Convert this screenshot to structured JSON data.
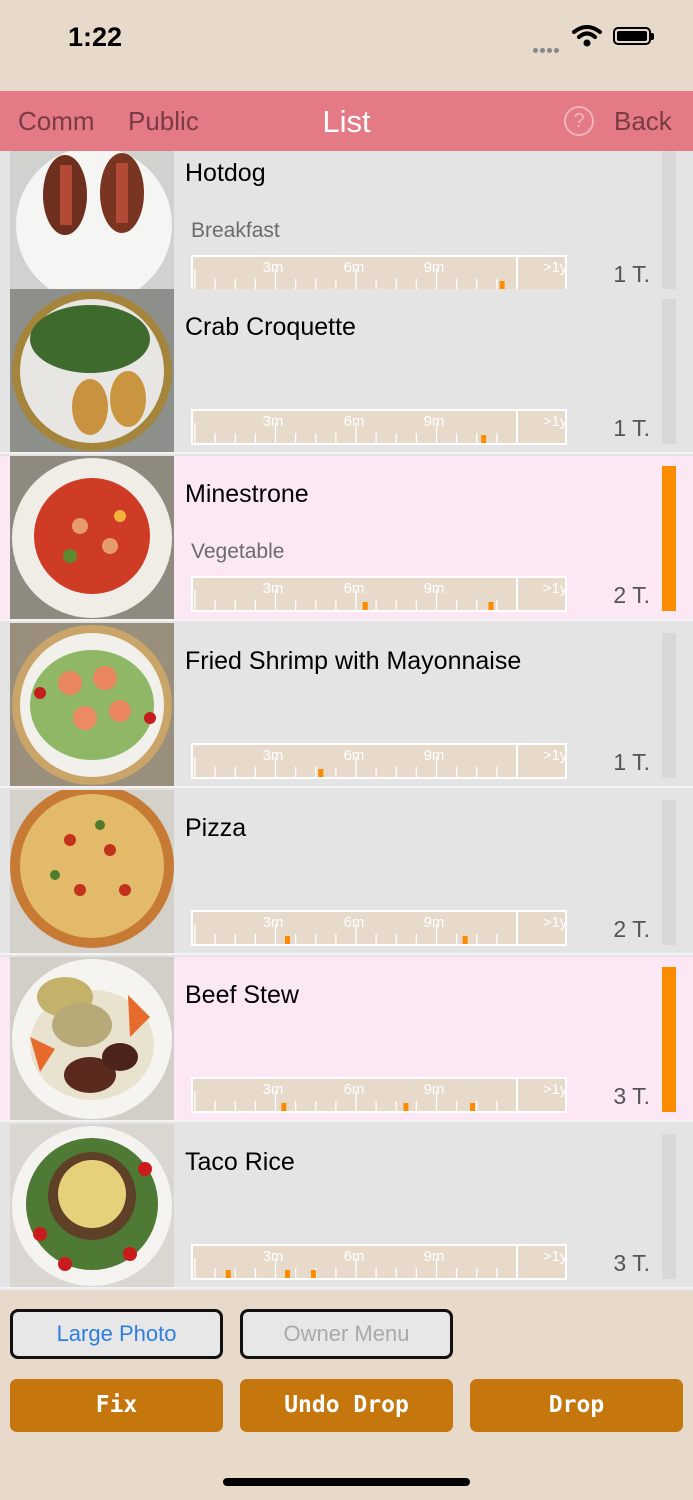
{
  "status": {
    "time": "1:22"
  },
  "nav": {
    "left1": "Comm",
    "left2": "Public",
    "title": "List",
    "help_icon": "?",
    "back": "Back"
  },
  "timeline_labels": [
    "3m",
    "6m",
    "9m",
    ">1y"
  ],
  "rows": [
    {
      "name": "Hotdog",
      "category": "Breakfast",
      "times": "1 T.",
      "highlight": false,
      "marks": [
        0.83
      ]
    },
    {
      "name": "Crab Croquette",
      "category": "",
      "times": "1 T.",
      "highlight": false,
      "marks": [
        0.78
      ]
    },
    {
      "name": "Minestrone",
      "category": "Vegetable",
      "times": "2 T.",
      "highlight": true,
      "marks": [
        0.46,
        0.8
      ]
    },
    {
      "name": "Fried Shrimp with Mayonnaise",
      "category": "",
      "times": "1 T.",
      "highlight": false,
      "marks": [
        0.34
      ]
    },
    {
      "name": "Pizza",
      "category": "",
      "times": "2 T.",
      "highlight": false,
      "marks": [
        0.25,
        0.73
      ]
    },
    {
      "name": "Beef Stew",
      "category": "",
      "times": "3 T.",
      "highlight": true,
      "marks": [
        0.24,
        0.57,
        0.75
      ]
    },
    {
      "name": "Taco Rice",
      "category": "",
      "times": "3 T.",
      "highlight": false,
      "marks": [
        0.09,
        0.25,
        0.32
      ]
    }
  ],
  "buttons": {
    "large_photo": "Large Photo",
    "owner_menu": "Owner Menu",
    "fix": "Fix",
    "undo_drop": "Undo Drop",
    "drop": "Drop"
  },
  "colors": {
    "nav": "#e37a86",
    "accent": "#fb8c00",
    "button": "#c5760d",
    "highlight_row": "#fce8f5"
  }
}
